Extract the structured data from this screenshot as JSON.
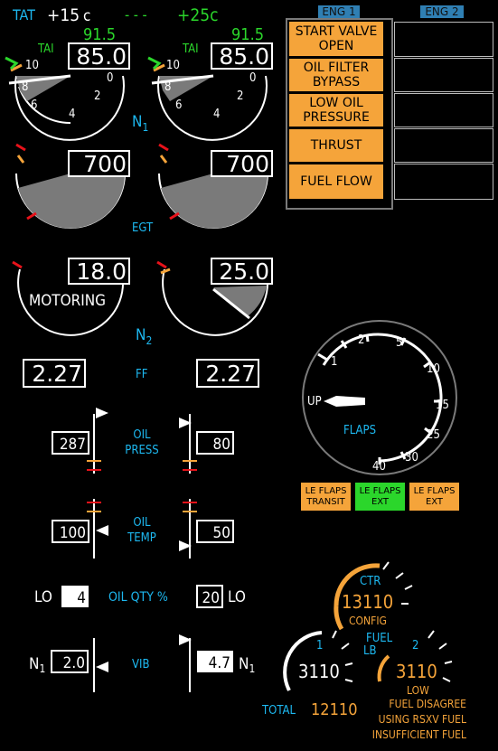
{
  "colors": {
    "cyan": "#1db8f0",
    "green": "#2bd62b",
    "amber": "#f5a43a",
    "red": "#e8121a",
    "white": "#ffffff",
    "grey": "#7a7a7a",
    "yellow": "#f5a43a"
  },
  "header": {
    "tat_label": "TAT",
    "tat_value": "+15",
    "tat_unit": "c",
    "dashes": "- - -",
    "sel_temp": "+25c"
  },
  "n1": {
    "left": {
      "target": "91.5",
      "value": "85.0",
      "tai": "TAI"
    },
    "right": {
      "target": "91.5",
      "value": "85.0",
      "tai": "TAI"
    },
    "ticks": [
      "10",
      "8",
      "6",
      "4",
      "2",
      "0"
    ],
    "label": "N",
    "label_sub": "1"
  },
  "egt": {
    "left": "700",
    "right": "700",
    "label": "EGT"
  },
  "n2": {
    "left": "18.0",
    "right": "25.0",
    "label": "N",
    "label_sub": "2",
    "motoring": "MOTORING"
  },
  "ff": {
    "left": "2.27",
    "right": "2.27",
    "label": "FF"
  },
  "oil_press": {
    "left": "287",
    "right": "80",
    "label_line1": "OIL",
    "label_line2": "PRESS"
  },
  "oil_temp": {
    "left": "100",
    "right": "50",
    "label_line1": "OIL",
    "label_line2": "TEMP"
  },
  "oil_qty": {
    "lo_left": "LO",
    "left": "4",
    "label": "OIL QTY %",
    "right": "20",
    "lo_right": "LO"
  },
  "vib": {
    "n_left": "N",
    "sub_left": "1",
    "left": "2.0",
    "label": "VIB",
    "right": "4.7",
    "n_right": "N",
    "sub_right": "1"
  },
  "alerts": {
    "eng1_label": "ENG 1",
    "eng2_label": "ENG 2",
    "items": [
      {
        "line1": "START VALVE",
        "line2": "OPEN"
      },
      {
        "line1": "OIL FILTER",
        "line2": "BYPASS"
      },
      {
        "line1": "LOW OIL",
        "line2": "PRESSURE"
      },
      {
        "line1": "THRUST",
        "line2": ""
      },
      {
        "line1": "FUEL FLOW",
        "line2": ""
      }
    ]
  },
  "flaps": {
    "label": "FLAPS",
    "up": "UP",
    "marks": [
      "1",
      "2",
      "5",
      "10",
      "15",
      "25",
      "30",
      "40"
    ],
    "le_boxes": [
      {
        "line1": "LE FLAPS",
        "line2": "TRANSIT",
        "color": "amber"
      },
      {
        "line1": "LE FLAPS",
        "line2": "EXT",
        "color": "green"
      },
      {
        "line1": "LE FLAPS",
        "line2": "EXT",
        "color": "amber"
      }
    ]
  },
  "fuel": {
    "ctr_label": "CTR",
    "ctr_value": "13110",
    "config": "CONFIG",
    "fuel_label": "FUEL",
    "lb_label": "LB",
    "tank1_label": "1",
    "tank2_label": "2",
    "tank1_value": "3110",
    "tank2_value": "3110",
    "low": "LOW",
    "total_label": "TOTAL",
    "total_value": "12110",
    "messages": [
      "FUEL DISAGREE",
      "USING RSXV FUEL",
      "INSUFFICIENT FUEL"
    ]
  }
}
